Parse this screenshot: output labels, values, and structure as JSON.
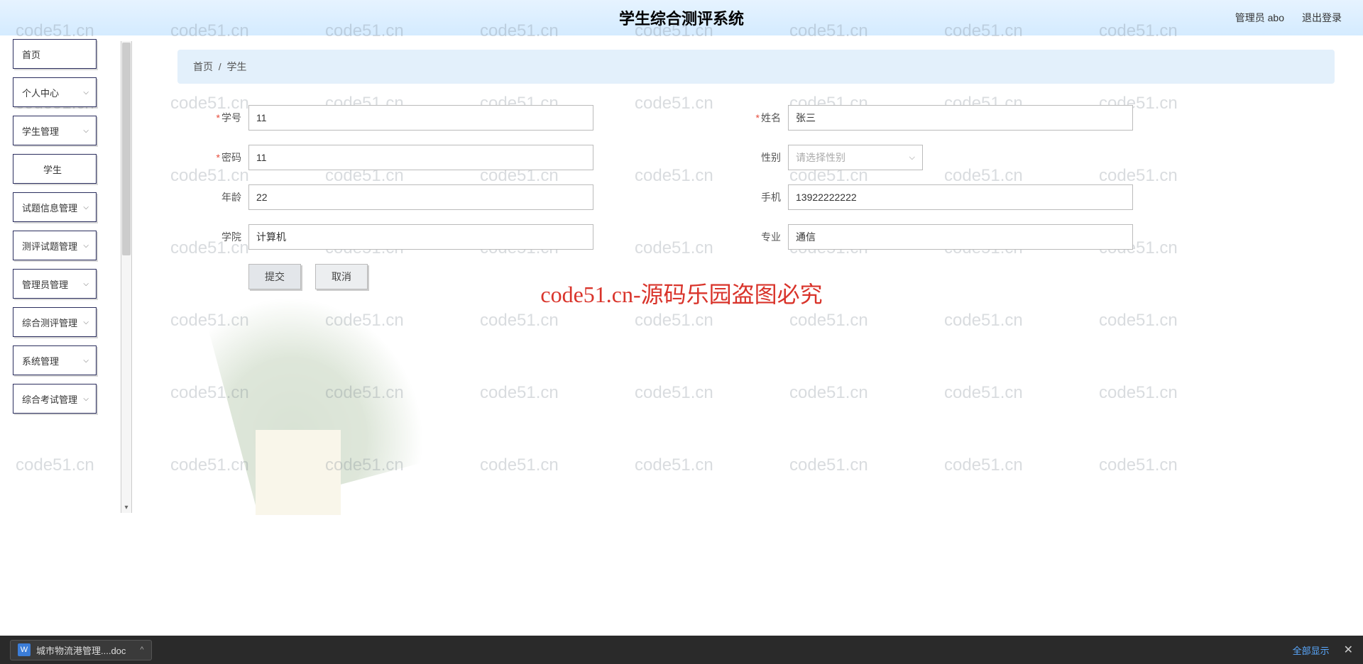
{
  "header": {
    "title": "学生综合测评系统",
    "admin_label": "管理员 abo",
    "logout_label": "退出登录"
  },
  "sidebar": {
    "items": [
      {
        "label": "首页",
        "expandable": false
      },
      {
        "label": "个人中心",
        "expandable": true
      },
      {
        "label": "学生管理",
        "expandable": true
      },
      {
        "label": "学生",
        "expandable": false,
        "indent": true
      },
      {
        "label": "试题信息管理",
        "expandable": true
      },
      {
        "label": "测评试题管理",
        "expandable": true
      },
      {
        "label": "管理员管理",
        "expandable": true
      },
      {
        "label": "综合测评管理",
        "expandable": true
      },
      {
        "label": "系统管理",
        "expandable": true
      },
      {
        "label": "综合考试管理",
        "expandable": true
      }
    ]
  },
  "breadcrumb": {
    "home": "首页",
    "sep": "/",
    "current": "学生"
  },
  "form": {
    "student_id": {
      "label": "学号",
      "value": "11",
      "required": true
    },
    "name": {
      "label": "姓名",
      "value": "张三",
      "required": true
    },
    "password": {
      "label": "密码",
      "value": "11",
      "required": true
    },
    "gender": {
      "label": "性别",
      "placeholder": "请选择性别",
      "value": ""
    },
    "age": {
      "label": "年龄",
      "value": "22"
    },
    "phone": {
      "label": "手机",
      "value": "13922222222"
    },
    "college": {
      "label": "学院",
      "value": "计算机"
    },
    "major": {
      "label": "专业",
      "value": "通信"
    },
    "submit_label": "提交",
    "cancel_label": "取消"
  },
  "watermark": {
    "text": "code51.cn",
    "big_text": "code51.cn-源码乐园盗图必究"
  },
  "download_bar": {
    "file_name": "城市物流港管理....doc",
    "show_all": "全部显示"
  }
}
